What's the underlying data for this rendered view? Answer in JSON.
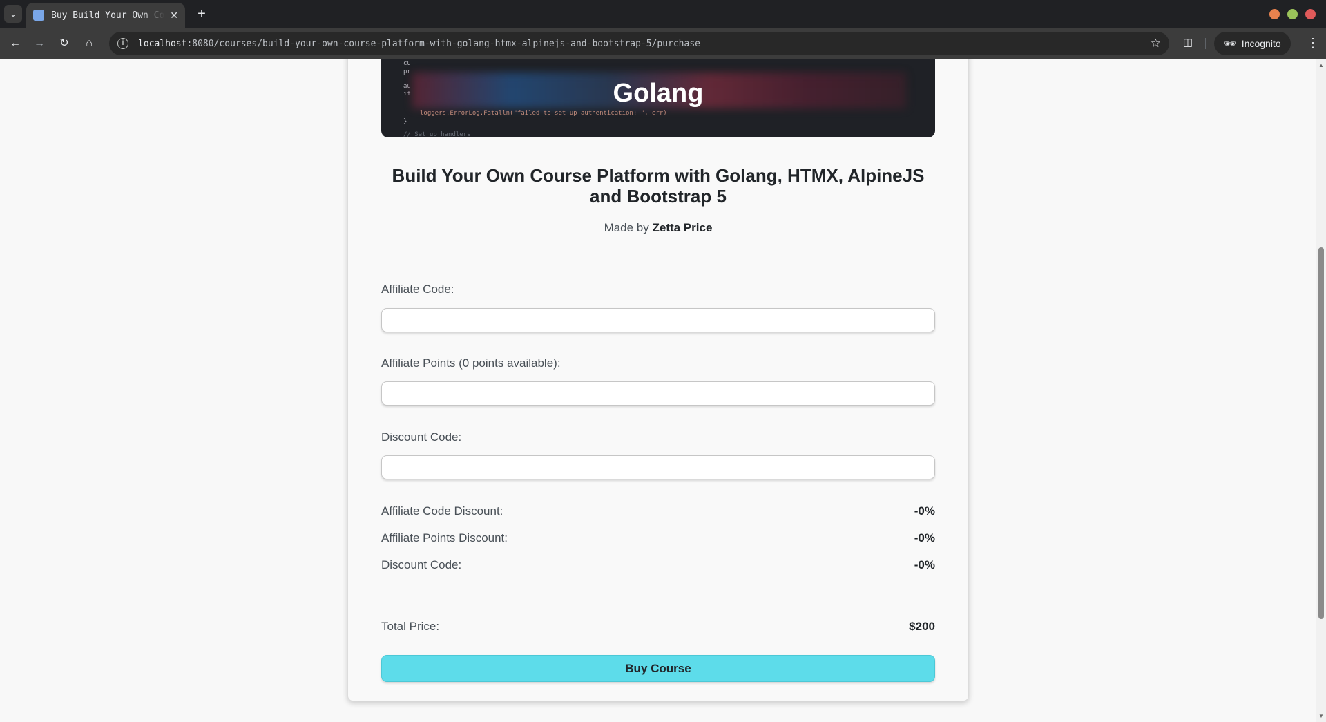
{
  "browser": {
    "tab_title": "Buy Build Your Own Course Platform",
    "url_host": "localhost",
    "url_path": ":8080/courses/build-your-own-course-platform-with-golang-htmx-alpinejs-and-bootstrap-5/purchase",
    "incognito_label": "Incognito"
  },
  "course": {
    "image_title": "Golang",
    "image_code": [
      "cu",
      "pr",
      "au",
      "if",
      "loggers.ErrorLog.Fatalln(\"failed to set up authentication: \", err)",
      "}",
      "// Set up handlers"
    ],
    "title_line1": "Build Your Own Course Platform with Golang, HTMX, AlpineJS",
    "title_line2": "and Bootstrap 5",
    "made_by_prefix": "Made by ",
    "author": "Zetta Price"
  },
  "form": {
    "affiliate_code_label": "Affiliate Code:",
    "affiliate_code_value": "",
    "affiliate_points_label": "Affiliate Points (0 points available):",
    "affiliate_points_value": "",
    "discount_code_label": "Discount Code:",
    "discount_code_value": ""
  },
  "summary": {
    "rows": [
      {
        "label": "Affiliate Code Discount:",
        "value": "-0%"
      },
      {
        "label": "Affiliate Points Discount:",
        "value": "-0%"
      },
      {
        "label": "Discount Code:",
        "value": "-0%"
      }
    ],
    "total_label": "Total Price:",
    "total_value": "$200",
    "buy_label": "Buy Course"
  },
  "colors": {
    "buy_button": "#5ddcea",
    "tabbar": "#202124",
    "toolbar": "#3c3c3c"
  }
}
